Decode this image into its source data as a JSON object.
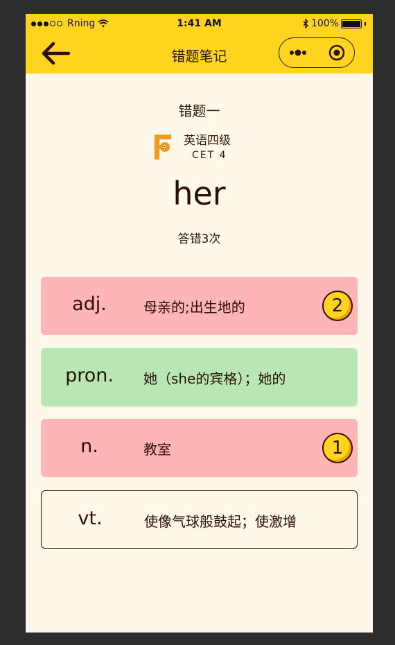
{
  "status_bar": {
    "carrier": "Rning",
    "time": "1:41 AM",
    "battery": "100%"
  },
  "nav": {
    "title": "错题笔记",
    "icons": [
      "back-arrow-icon",
      "more-icon",
      "close-circle-icon"
    ]
  },
  "content": {
    "heading": "错题一",
    "exam_cn": "英语四级",
    "exam_en": "CET 4",
    "word": "her",
    "wrong_times": "答错3次"
  },
  "options": [
    {
      "pos": "adj.",
      "meaning": "母亲的;出生地的",
      "state": "wrong",
      "count": "2"
    },
    {
      "pos": "pron.",
      "meaning": "她（she的宾格）；她的",
      "state": "correct",
      "count": ""
    },
    {
      "pos": "n.",
      "meaning": "教室",
      "state": "wrong",
      "count": "1"
    },
    {
      "pos": "vt.",
      "meaning": "使像气球般鼓起；使激增",
      "state": "plain",
      "count": ""
    }
  ],
  "colors": {
    "header": "#ffd41f",
    "background": "#fef8ea",
    "wrong": "#ffb5b5",
    "correct": "#b8e6b5",
    "text": "#2a1000"
  }
}
